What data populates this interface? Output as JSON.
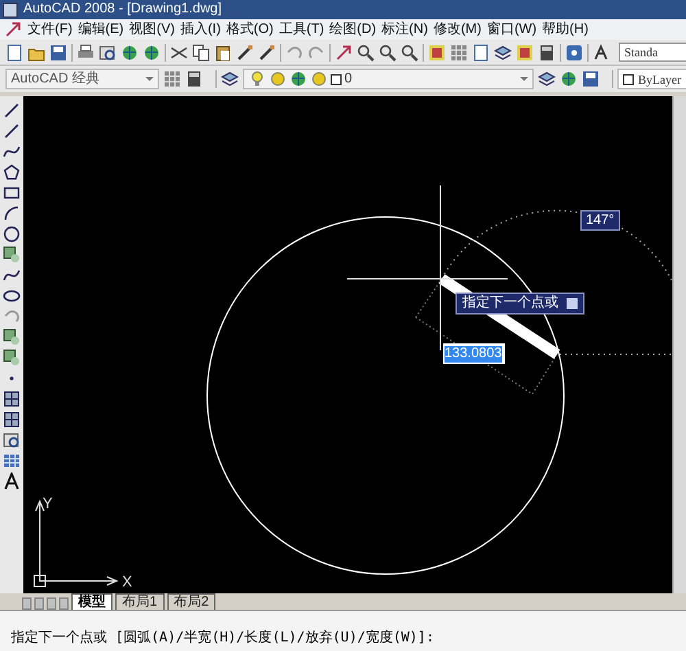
{
  "window": {
    "title": "AutoCAD 2008 - [Drawing1.dwg]"
  },
  "menu": [
    "文件(F)",
    "编辑(E)",
    "视图(V)",
    "插入(I)",
    "格式(O)",
    "工具(T)",
    "绘图(D)",
    "标注(N)",
    "修改(M)",
    "窗口(W)",
    "帮助(H)"
  ],
  "toolbar": {
    "text_style": "Standa"
  },
  "workspace": {
    "value": "AutoCAD 经典"
  },
  "layer": {
    "value": "0"
  },
  "color": {
    "value": "ByLayer"
  },
  "drawing": {
    "angle": "147°",
    "prompt": "指定下一个点或",
    "length": "133.0803",
    "ucs_y": "Y",
    "ucs_x": "X"
  },
  "tabs": [
    {
      "label": "模型",
      "selected": true
    },
    {
      "label": "布局1",
      "selected": false
    },
    {
      "label": "布局2",
      "selected": false
    }
  ],
  "command_line": "指定下一个点或 [圆弧(A)/半宽(H)/长度(L)/放弃(U)/宽度(W)]:"
}
